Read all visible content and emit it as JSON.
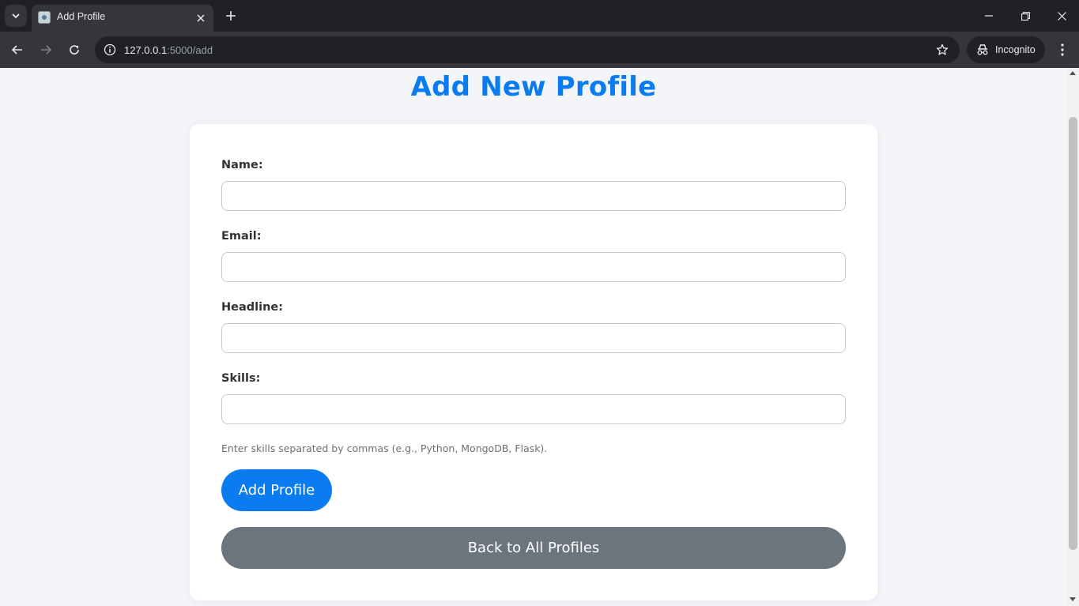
{
  "browser": {
    "tab_title": "Add Profile",
    "url_host": "127.0.0.1",
    "url_rest": ":5000/add",
    "incognito_label": "Incognito",
    "icons": [
      "tab-search-icon",
      "close-icon",
      "plus-icon",
      "minimize-icon",
      "restore-icon",
      "window-close-icon",
      "back-arrow-icon",
      "forward-arrow-icon",
      "reload-icon",
      "site-info-icon",
      "star-icon",
      "incognito-icon",
      "kebab-menu-icon"
    ]
  },
  "page": {
    "title": "Add New Profile",
    "title_color": "#0a7cf0",
    "form": {
      "name_label": "Name:",
      "name_value": "",
      "email_label": "Email:",
      "email_value": "",
      "headline_label": "Headline:",
      "headline_value": "",
      "skills_label": "Skills:",
      "skills_value": "",
      "skills_hint": "Enter skills separated by commas (e.g., Python, MongoDB, Flask).",
      "submit_label": "Add Profile"
    },
    "back_link_label": "Back to All Profiles",
    "colors": {
      "primary": "#0a7cf0",
      "secondary": "#6c757d",
      "background": "#f4f5f8",
      "card": "#ffffff"
    }
  }
}
